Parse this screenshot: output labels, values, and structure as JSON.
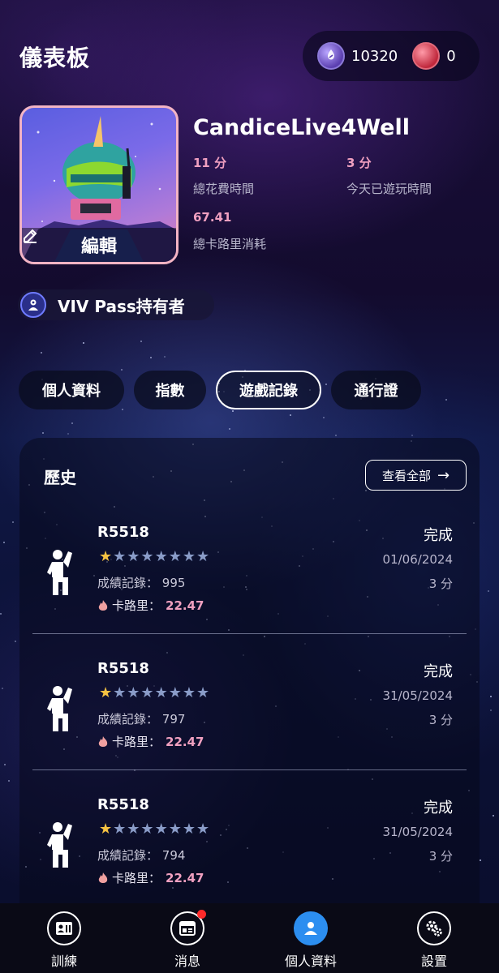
{
  "header": {
    "title": "儀表板"
  },
  "currency": {
    "coins": "10320",
    "gems": "0"
  },
  "profile": {
    "username": "CandiceLive4Well",
    "edit_label": "編輯",
    "stats": [
      {
        "value": "11 分",
        "label": "總花費時間"
      },
      {
        "value": "3 分",
        "label": "今天已遊玩時間"
      },
      {
        "value": "67.41",
        "label": "總卡路里消耗"
      }
    ],
    "pass_label": "VIV Pass持有者"
  },
  "tabs": [
    {
      "label": "個人資料",
      "active": false
    },
    {
      "label": "指數",
      "active": false
    },
    {
      "label": "遊戲記錄",
      "active": true
    },
    {
      "label": "通行證",
      "active": false
    }
  ],
  "history": {
    "title": "歷史",
    "view_all": "查看全部",
    "view_all_arrow": "→",
    "records": [
      {
        "name": "R5518",
        "stars_on": 1,
        "stars_total": 8,
        "score_label": "成績記錄：",
        "score": "995",
        "cal_label": "卡路里：",
        "calories": "22.47",
        "status": "完成",
        "date": "01/06/2024",
        "duration": "3 分"
      },
      {
        "name": "R5518",
        "stars_on": 1,
        "stars_total": 8,
        "score_label": "成績記錄：",
        "score": "797",
        "cal_label": "卡路里：",
        "calories": "22.47",
        "status": "完成",
        "date": "31/05/2024",
        "duration": "3 分"
      },
      {
        "name": "R5518",
        "stars_on": 1,
        "stars_total": 8,
        "score_label": "成績記錄：",
        "score": "794",
        "cal_label": "卡路里：",
        "calories": "22.47",
        "status": "完成",
        "date": "31/05/2024",
        "duration": "3 分"
      }
    ]
  },
  "nav": {
    "items": [
      {
        "label": "訓練",
        "icon": "training-icon",
        "active": false
      },
      {
        "label": "消息",
        "icon": "news-icon",
        "active": false,
        "badge": true
      },
      {
        "label": "個人資料",
        "icon": "profile-icon",
        "active": true
      },
      {
        "label": "設置",
        "icon": "settings-icon",
        "active": false
      }
    ]
  },
  "colors": {
    "accent": "#2c8ef0",
    "stat": "#f0a0c0",
    "star_on": "#f5c242",
    "badge": "#ff2a2a"
  }
}
